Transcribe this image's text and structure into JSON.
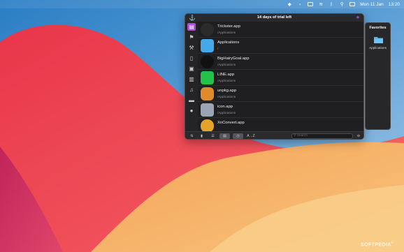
{
  "menubar": {
    "date": "Mon 11 Jan",
    "time": "13:20"
  },
  "panel": {
    "title": "14 days of trial left"
  },
  "apps": [
    {
      "name": "Trickster.app",
      "path": "/Applications",
      "color": "#2b2b2b"
    },
    {
      "name": "Applications",
      "path": "/",
      "color": "#45a8e8"
    },
    {
      "name": "BigHairyGoal.app",
      "path": "/Applications",
      "color": "#111111"
    },
    {
      "name": "LINE.app",
      "path": "/Applications",
      "color": "#22c348"
    },
    {
      "name": "unpkg.app",
      "path": "/Applications",
      "color": "#e08a2c"
    },
    {
      "name": "icon.app",
      "path": "/Applications",
      "color": "#9aa4b4"
    },
    {
      "name": "XnConvert.app",
      "path": "",
      "color": "#e4a32a"
    }
  ],
  "bottombar": {
    "sort_label": "A→Z",
    "search_placeholder": "Search"
  },
  "favorites": {
    "title": "Favorites",
    "items": [
      {
        "label": "Applications"
      }
    ]
  },
  "watermark": "SOFTPEDIA"
}
